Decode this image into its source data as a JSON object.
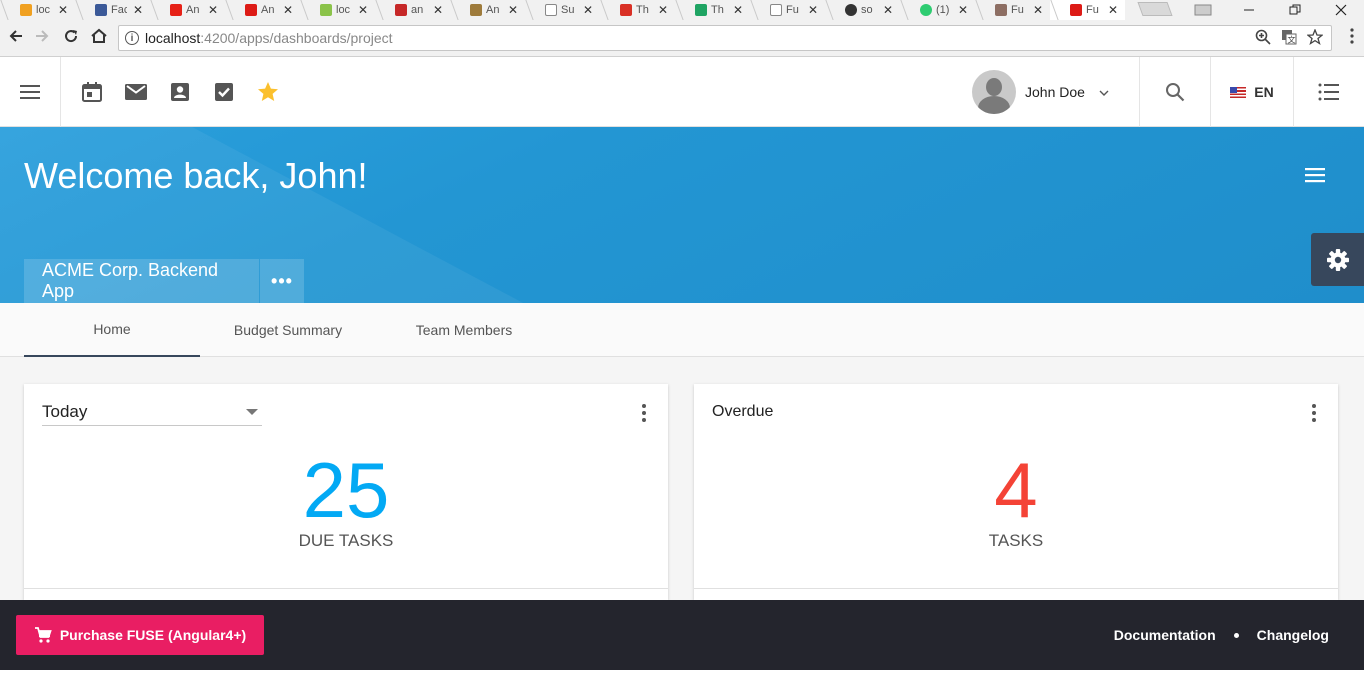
{
  "browser": {
    "tabs": [
      {
        "title": "loc",
        "favicon_color": "#f0a020"
      },
      {
        "title": "Fac",
        "favicon_color": "#3b5998"
      },
      {
        "title": "An",
        "favicon_color": "#e62117"
      },
      {
        "title": "An",
        "favicon_color": "#dd1b16"
      },
      {
        "title": "loc",
        "favicon_color": "#8bc34a"
      },
      {
        "title": "an",
        "favicon_color": "#c62828"
      },
      {
        "title": "An",
        "favicon_color": "#9e7b3b"
      },
      {
        "title": "Su",
        "favicon_color": "#ffffff"
      },
      {
        "title": "Th",
        "favicon_color": "#d93025"
      },
      {
        "title": "Th",
        "favicon_color": "#1fa463"
      },
      {
        "title": "Fu",
        "favicon_color": "#ffffff"
      },
      {
        "title": "so",
        "favicon_color": "#333333"
      },
      {
        "title": "(1)",
        "favicon_color": "#2ecc71"
      },
      {
        "title": "Fu",
        "favicon_color": "#8d6e63"
      },
      {
        "title": "Fu",
        "favicon_color": "#dd1b16"
      }
    ],
    "close_glyph": "✕",
    "url_host": "localhost",
    "url_path": ":4200/apps/dashboards/project"
  },
  "toolbar": {
    "user_name": "John Doe",
    "language": "EN"
  },
  "header": {
    "welcome": "Welcome back, John!",
    "project_name": "ACME Corp. Backend App",
    "project_more": "•••"
  },
  "tabs": [
    {
      "label": "Home"
    },
    {
      "label": "Budget Summary"
    },
    {
      "label": "Team Members"
    }
  ],
  "widgets": {
    "due": {
      "selected_range": "Today",
      "count": "25",
      "label": "DUE TASKS",
      "color": "#03a9f4"
    },
    "overdue": {
      "title": "Overdue",
      "count": "4",
      "label": "TASKS",
      "color": "#f44336"
    }
  },
  "footer": {
    "purchase_label": "Purchase FUSE (Angular4+)",
    "documentation": "Documentation",
    "changelog": "Changelog"
  },
  "colors": {
    "header_blue": "#2396d3",
    "accent_pink": "#e91e63",
    "footer_dark": "#24252d",
    "star": "#fbc02d"
  }
}
